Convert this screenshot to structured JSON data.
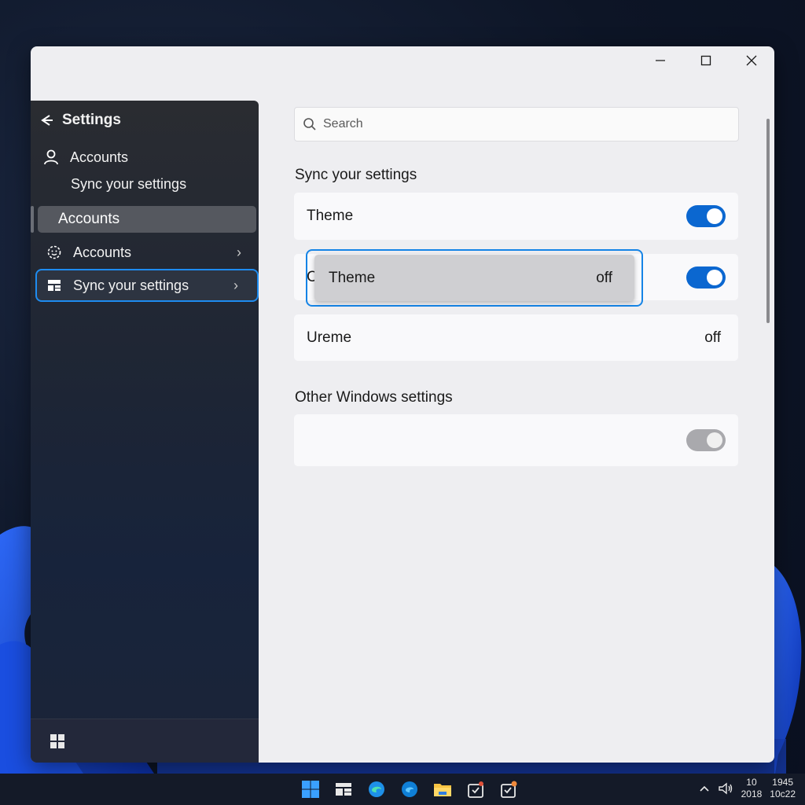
{
  "sidebar": {
    "title": "Settings",
    "nav_accounts": "Accounts",
    "nav_sync": "Sync your settings",
    "selected": "Accounts",
    "item_accounts": "Accounts",
    "item_sync": "Sync your settings"
  },
  "search": {
    "placeholder": "Search"
  },
  "sections": {
    "sync_title": "Sync your settings",
    "other_title": "Other Windows settings"
  },
  "cards": [
    {
      "label": "Theme",
      "toggle": "on"
    },
    {
      "label": "C",
      "toggle": "on"
    },
    {
      "label": "Ureme",
      "state": "off"
    }
  ],
  "popup": {
    "label": "Theme",
    "state": "off"
  },
  "other_card": {
    "toggle": "on-disabled"
  },
  "taskbar": {
    "tray_top": "10",
    "tray_bottom": "2018",
    "clock_time": "1945",
    "clock_date": "10c22"
  },
  "colors": {
    "accent": "#0b67d0",
    "focus": "#1584e6"
  }
}
